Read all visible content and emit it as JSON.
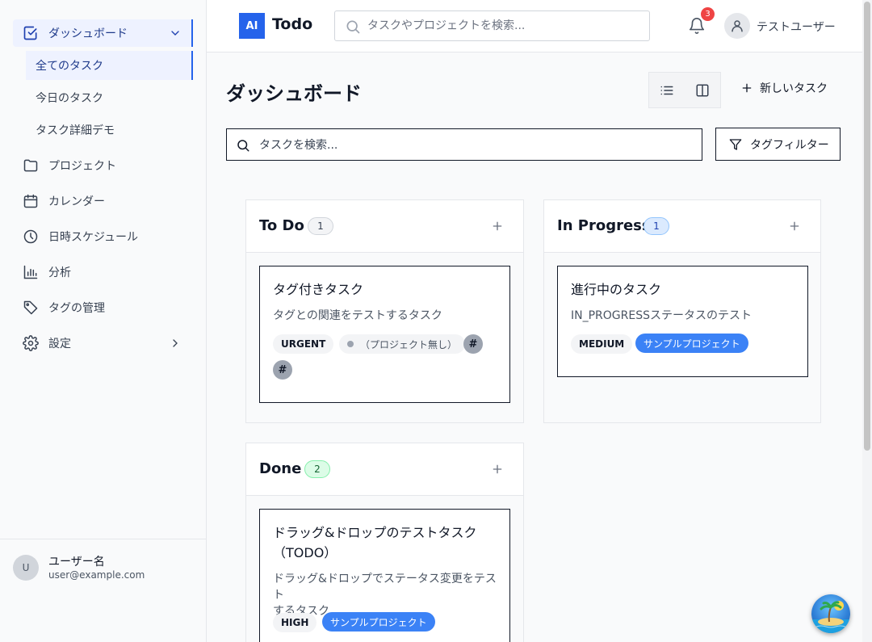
{
  "sidebar": {
    "main_item": "ダッシュボード",
    "sub_items": [
      "全てのタスク",
      "今日のタスク",
      "タスク詳細デモ"
    ],
    "items": [
      {
        "label": "プロジェクト",
        "icon": "folder-icon"
      },
      {
        "label": "カレンダー",
        "icon": "calendar-icon"
      },
      {
        "label": "日時スケジュール",
        "icon": "clock-icon"
      },
      {
        "label": "分析",
        "icon": "bar-chart-icon"
      },
      {
        "label": "タグの管理",
        "icon": "tag-icon"
      },
      {
        "label": "設定",
        "icon": "gear-icon"
      }
    ],
    "user": {
      "initial": "U",
      "name": "ユーザー名",
      "email": "user@example.com"
    }
  },
  "header": {
    "logo_badge": "AI",
    "logo_text": "Todo",
    "search_placeholder": "タスクやプロジェクトを検索...",
    "notification_count": "3",
    "user_name": "テストユーザー"
  },
  "main": {
    "title": "ダッシュボード",
    "new_task_label": "新しいタスク",
    "task_search_placeholder": "タスクを検索...",
    "tag_filter_label": "タグフィルター"
  },
  "columns": [
    {
      "title": "To Do",
      "count": "1",
      "cards": [
        {
          "title": "タグ付きタスク",
          "description": "タグとの関連をテストするタスク",
          "priority": "URGENT",
          "project": "（プロジェクト無し）",
          "tags": [
            "#",
            "#"
          ]
        }
      ]
    },
    {
      "title": "In Progress",
      "count": "1",
      "cards": [
        {
          "title": "進行中のタスク",
          "description": "IN_PROGRESSステータスのテスト",
          "priority": "MEDIUM",
          "project": "サンプルプロジェクト"
        }
      ]
    },
    {
      "title": "Done",
      "count": "2",
      "cards": [
        {
          "title_line1": "ドラッグ&ドロップのテストタスク",
          "title_line2": "（TODO）",
          "description_line1": "ドラッグ&ドロップでステータス変更をテスト",
          "description_line2": "するタスク",
          "priority": "HIGH",
          "project": "サンプルプロジェクト"
        }
      ]
    }
  ],
  "colors": {
    "accent": "#2563eb",
    "project_chip": "#3b82f6",
    "notification_badge": "#ef4444"
  }
}
